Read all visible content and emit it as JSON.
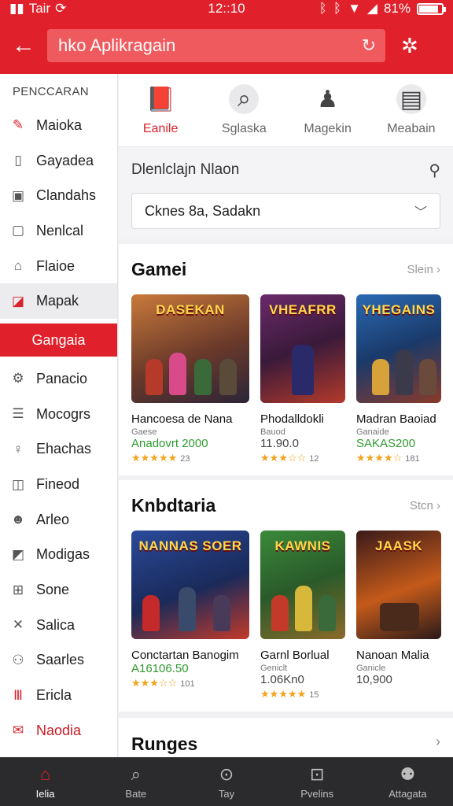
{
  "status": {
    "carrier": "Tair",
    "time": "12::10",
    "battery": "81%"
  },
  "appbar": {
    "search_value": "hko Aplikragain"
  },
  "sidebar": {
    "title": "PENCCARAN",
    "items": [
      {
        "label": "Maioka",
        "icon": "wrench-icon"
      },
      {
        "label": "Gayadea",
        "icon": "file-icon"
      },
      {
        "label": "Clandahs",
        "icon": "calendar-icon"
      },
      {
        "label": "Nenlcal",
        "icon": "edit-icon"
      },
      {
        "label": "Flaioe",
        "icon": "building-icon"
      },
      {
        "label": "Mapak",
        "icon": "tag-icon"
      },
      {
        "label": "Gangaia",
        "icon": ""
      },
      {
        "label": "Panacio",
        "icon": "gear-icon"
      },
      {
        "label": "Mocogrs",
        "icon": "document-icon"
      },
      {
        "label": "Ehachas",
        "icon": "pin-icon"
      },
      {
        "label": "Fineod",
        "icon": "box-icon"
      },
      {
        "label": "Arleo",
        "icon": "person-icon"
      },
      {
        "label": "Modigas",
        "icon": "image-icon"
      },
      {
        "label": "Sone",
        "icon": "grid-icon"
      },
      {
        "label": "Salica",
        "icon": "tools-icon"
      },
      {
        "label": "Saarles",
        "icon": "people-icon"
      },
      {
        "label": "Ericla",
        "icon": "bars-icon"
      },
      {
        "label": "Naodia",
        "icon": "mail-icon"
      }
    ]
  },
  "categories": [
    {
      "label": "Eanile"
    },
    {
      "label": "Sglaska"
    },
    {
      "label": "Magekin"
    },
    {
      "label": "Meabain"
    }
  ],
  "filter": {
    "label": "Dlenlclajn Nlaon",
    "dropdown_value": "Cknes 8a, Sadakn"
  },
  "section1": {
    "title": "Gamei",
    "more": "Slein",
    "cards": [
      {
        "thumb_text": "DASEKAN",
        "title": "Hancoesa de Nana",
        "sub": "Gaese",
        "price": "Anadovrt 2000",
        "rating": "★★★★★",
        "count": "23"
      },
      {
        "thumb_text": "VHEAFRR",
        "title": "Phodalldokli",
        "sub": "Bauod",
        "price": "11.90.0",
        "rating": "★★★☆☆",
        "count": "12"
      },
      {
        "thumb_text": "YHEGAINS",
        "title": "Madran Baoiad",
        "sub": "Ganaide",
        "price": "SAKAS200",
        "rating": "★★★★☆",
        "count": "181"
      }
    ]
  },
  "section2": {
    "title": "Knbdtaria",
    "more": "Stcn",
    "cards": [
      {
        "thumb_text": "NANNAS SOER",
        "title": "Conctartan Banogim",
        "sub": "",
        "price": "A16106.50",
        "rating": "★★★☆☆",
        "count": "101"
      },
      {
        "thumb_text": "KAWNIS",
        "title": "Garnl Borlual",
        "sub": "Geniclt",
        "price": "1.06Kn0",
        "rating": "★★★★★",
        "count": "15"
      },
      {
        "thumb_text": "JAASK",
        "title": "Nanoan Malia",
        "sub": "Ganicle",
        "price": "10,900",
        "rating": "",
        "count": ""
      }
    ]
  },
  "section3": {
    "title": "Runges"
  },
  "bottomnav": [
    {
      "label": "Ielia",
      "icon": "home-icon"
    },
    {
      "label": "Bate",
      "icon": "search-icon"
    },
    {
      "label": "Tay",
      "icon": "upload-icon"
    },
    {
      "label": "Pvelins",
      "icon": "download-icon"
    },
    {
      "label": "Attagata",
      "icon": "account-icon"
    }
  ]
}
